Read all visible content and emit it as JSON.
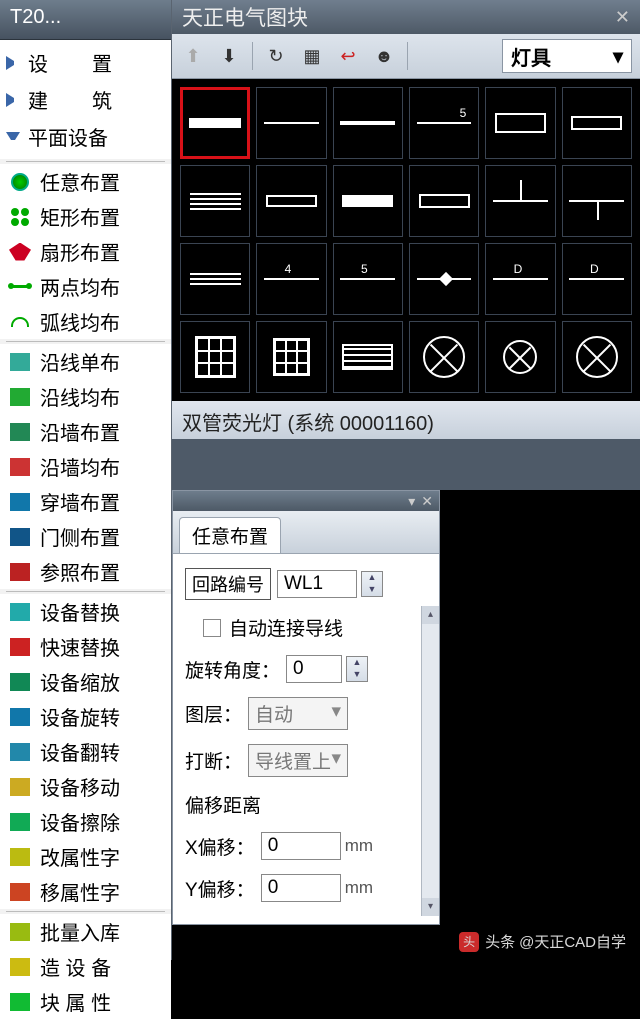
{
  "sidebar": {
    "title": "T20...",
    "tree": [
      {
        "label": "设　置",
        "expanded": false
      },
      {
        "label": "建　筑",
        "expanded": false
      },
      {
        "label": "平面设备",
        "expanded": true
      }
    ],
    "groups": [
      [
        "任意布置",
        "矩形布置",
        "扇形布置",
        "两点均布",
        "弧线均布"
      ],
      [
        "沿线单布",
        "沿线均布",
        "沿墙布置",
        "沿墙均布",
        "穿墙布置",
        "门侧布置",
        "参照布置"
      ],
      [
        "设备替换",
        "快速替换",
        "设备缩放",
        "设备旋转",
        "设备翻转",
        "设备移动",
        "设备擦除",
        "改属性字",
        "移属性字"
      ],
      [
        "批量入库",
        "造 设 备",
        "块 属 性"
      ]
    ]
  },
  "palette": {
    "title": "天正电气图块",
    "dropdown": "灯具",
    "selected_name": "双管荧光灯  (系统 00001160)"
  },
  "props": {
    "tab": "任意布置",
    "circuit_label": "回路编号",
    "circuit_value": "WL1",
    "autowire": "自动连接导线",
    "rotate_label": "旋转角度：",
    "rotate_value": "0",
    "layer_label": "图层：",
    "layer_value": "自动",
    "break_label": "打断：",
    "break_value": "导线置上",
    "offset_title": "偏移距离",
    "xoff_label": "X偏移：",
    "xoff_value": "0",
    "yoff_label": "Y偏移：",
    "yoff_value": "0",
    "unit": "mm"
  },
  "watermark": {
    "prefix": "头条",
    "handle": "@天正CAD自学"
  }
}
